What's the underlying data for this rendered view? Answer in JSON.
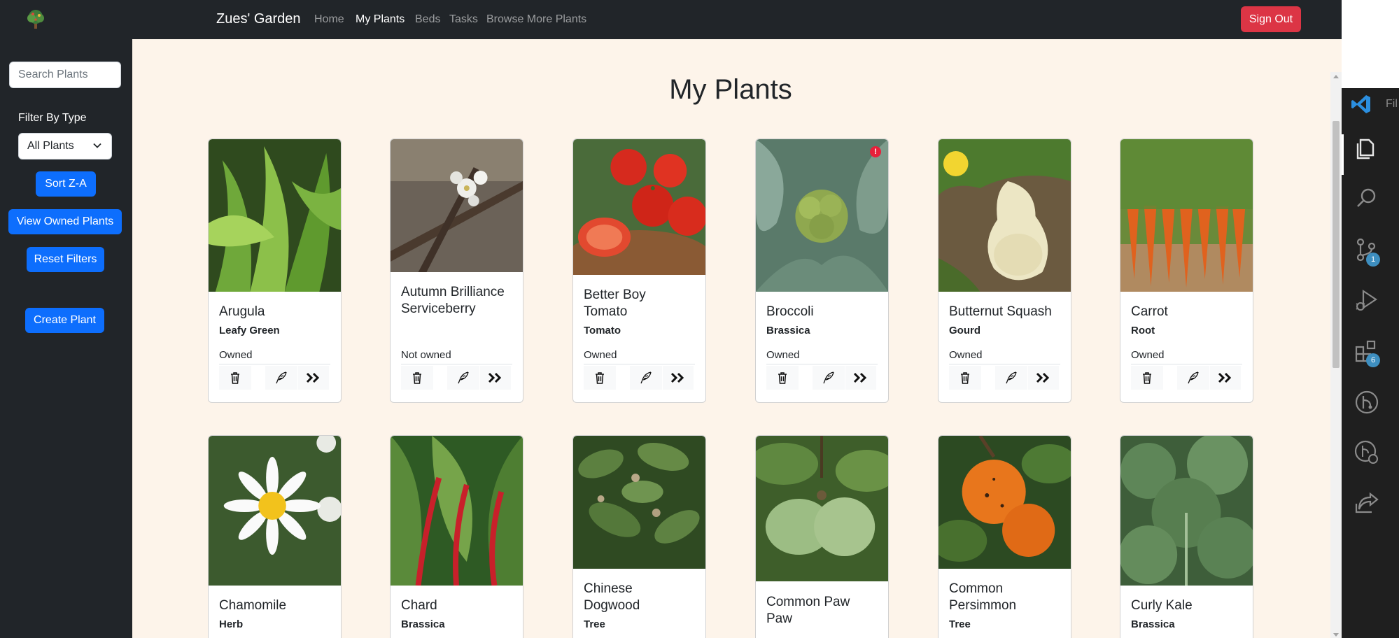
{
  "navbar": {
    "brand": "Zues' Garden",
    "links": [
      "Home",
      "My Plants",
      "Beds",
      "Tasks",
      "Browse More Plants"
    ],
    "active_link": "My Plants",
    "sign_out": "Sign Out"
  },
  "sidebar": {
    "search_placeholder": "Search Plants",
    "filter_label": "Filter By Type",
    "type_filter_value": "All Plants",
    "sort_button": "Sort Z-A",
    "owned_button": "View Owned Plants",
    "reset_button": "Reset Filters",
    "create_button": "Create Plant"
  },
  "main": {
    "title": "My Plants",
    "plants": [
      {
        "name": "Arugula",
        "type": "Leafy Green",
        "status": "Owned",
        "alert": false
      },
      {
        "name": "Autumn Brilliance Serviceberry",
        "type": "",
        "status": "Not owned",
        "alert": false
      },
      {
        "name": "Better Boy Tomato",
        "type": "Tomato",
        "status": "Owned",
        "alert": false
      },
      {
        "name": "Broccoli",
        "type": "Brassica",
        "status": "Owned",
        "alert": true,
        "alert_text": "!"
      },
      {
        "name": "Butternut Squash",
        "type": "Gourd",
        "status": "Owned",
        "alert": false
      },
      {
        "name": "Carrot",
        "type": "Root",
        "status": "Owned",
        "alert": false
      },
      {
        "name": "Chamomile",
        "type": "Herb",
        "status": "",
        "alert": false
      },
      {
        "name": "Chard",
        "type": "Brassica",
        "status": "",
        "alert": false
      },
      {
        "name": "Chinese Dogwood",
        "type": "Tree",
        "status": "",
        "alert": false
      },
      {
        "name": "Common Paw Paw",
        "type": "",
        "status": "",
        "alert": false
      },
      {
        "name": "Common Persimmon",
        "type": "Tree",
        "status": "",
        "alert": false
      },
      {
        "name": "Curly Kale",
        "type": "Brassica",
        "status": "",
        "alert": false
      }
    ]
  },
  "vscode": {
    "file_label": "Fil",
    "source_control_badge": "1",
    "extensions_badge": "6",
    "icons": [
      "vscode-logo-icon",
      "explorer-icon",
      "search-icon",
      "source-control-icon",
      "run-debug-icon",
      "extensions-icon",
      "git-graph-icon",
      "remote-explorer-icon",
      "live-share-icon"
    ]
  },
  "colors": {
    "navbar_bg": "#212529",
    "main_bg": "#fdf4ea",
    "primary": "#0d6efd",
    "danger": "#dc3545",
    "vscode_bg": "#1f1f1f"
  }
}
